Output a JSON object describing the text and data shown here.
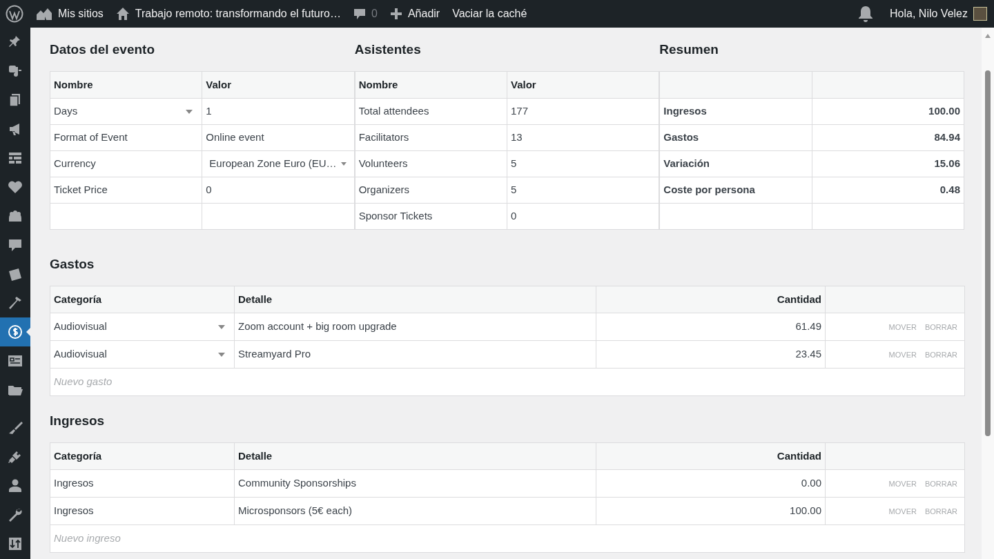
{
  "admin_bar": {
    "mis_sitios": "Mis sitios",
    "site_title": "Trabajo remoto: transformando el futuro…",
    "comments": "0",
    "add": "Añadir",
    "clear_cache": "Vaciar la caché",
    "greeting": "Hola, Nilo Velez"
  },
  "sidebar": {
    "items": [
      {
        "selected": false
      },
      {
        "selected": false
      },
      {
        "selected": false
      },
      {
        "selected": false
      },
      {
        "selected": false
      },
      {
        "selected": false
      },
      {
        "selected": false
      },
      {
        "selected": false
      },
      {
        "selected": false
      },
      {
        "selected": false
      },
      {
        "selected": true
      },
      {
        "selected": false
      },
      {
        "selected": false
      },
      {
        "selected": false
      },
      {
        "selected": false
      },
      {
        "selected": false
      },
      {
        "selected": false
      },
      {
        "selected": false
      }
    ]
  },
  "event_data": {
    "title": "Datos del evento",
    "columns": [
      "Nombre",
      "Valor"
    ],
    "rows": [
      {
        "name": "Days",
        "name_dropdown": true,
        "value": "1",
        "value_dropdown": false
      },
      {
        "name": "Format of Event",
        "name_dropdown": false,
        "value": "Online event",
        "value_dropdown": false
      },
      {
        "name": "Currency",
        "name_dropdown": false,
        "value": "European Zone Euro (EU…",
        "value_dropdown": true
      },
      {
        "name": "Ticket Price",
        "name_dropdown": false,
        "value": "0",
        "value_dropdown": false
      }
    ]
  },
  "attendees": {
    "title": "Asistentes",
    "columns": [
      "Nombre",
      "Valor"
    ],
    "rows": [
      {
        "name": "Total attendees",
        "value": "177"
      },
      {
        "name": "Facilitators",
        "value": "13"
      },
      {
        "name": "Volunteers",
        "value": "5"
      },
      {
        "name": "Organizers",
        "value": "5"
      },
      {
        "name": "Sponsor Tickets",
        "value": "0"
      }
    ]
  },
  "summary": {
    "title": "Resumen",
    "rows": [
      {
        "label": "Ingresos",
        "value": "100.00"
      },
      {
        "label": "Gastos",
        "value": "84.94"
      },
      {
        "label": "Variación",
        "value": "15.06"
      },
      {
        "label": "Coste por persona",
        "value": "0.48"
      }
    ]
  },
  "expenses": {
    "title": "Gastos",
    "columns": [
      "Categoría",
      "Detalle",
      "Cantidad"
    ],
    "rows": [
      {
        "category": "Audiovisual",
        "category_dropdown": true,
        "detail": "Zoom account + big room upgrade",
        "amount": "61.49",
        "move": "MOVER",
        "delete": "BORRAR"
      },
      {
        "category": "Audiovisual",
        "category_dropdown": true,
        "detail": "Streamyard Pro",
        "amount": "23.45",
        "move": "MOVER",
        "delete": "BORRAR"
      }
    ],
    "new_placeholder": "Nuevo gasto"
  },
  "income": {
    "title": "Ingresos",
    "columns": [
      "Categoría",
      "Detalle",
      "Cantidad"
    ],
    "rows": [
      {
        "category": "Ingresos",
        "category_dropdown": false,
        "detail": "Community Sponsorships",
        "amount": "0.00",
        "move": "MOVER",
        "delete": "BORRAR"
      },
      {
        "category": "Ingresos",
        "category_dropdown": false,
        "detail": "Microsponsors (5€ each)",
        "amount": "100.00",
        "move": "MOVER",
        "delete": "BORRAR"
      }
    ],
    "new_placeholder": "Nuevo ingreso"
  }
}
